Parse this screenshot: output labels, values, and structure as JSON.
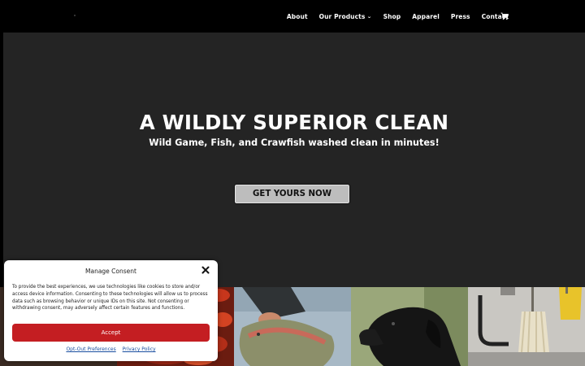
{
  "nav": {
    "items": [
      {
        "label": "About"
      },
      {
        "label": "Our Products",
        "has_dropdown": true
      },
      {
        "label": "Shop"
      },
      {
        "label": "Apparel"
      },
      {
        "label": "Press"
      },
      {
        "label": "Contact"
      }
    ],
    "cart_icon": "shopping-cart-icon"
  },
  "hero": {
    "title": "A WILDLY SUPERIOR CLEAN",
    "subtitle": "Wild Game, Fish, and Crawfish washed clean in minutes!",
    "cta_label": "GET YOURS NOW"
  },
  "photos": [
    {
      "name": "crawfish-photo"
    },
    {
      "name": "crawfish-closeup-photo"
    },
    {
      "name": "fish-catch-photo"
    },
    {
      "name": "black-labrador-photo"
    },
    {
      "name": "mop-sink-photo"
    }
  ],
  "consent": {
    "title": "Manage Consent",
    "body": "To provide the best experiences, we use technologies like cookies to store and/or access device information. Consenting to these technologies will allow us to process data such as browsing behavior or unique IDs on this site. Not consenting or withdrawing consent, may adversely affect certain features and functions.",
    "accept_label": "Accept",
    "opt_out_label": "Opt-Out Preferences",
    "privacy_label": "Privacy Policy"
  },
  "colors": {
    "header_bg": "#000000",
    "hero_bg": "#242424",
    "cta_bg": "#bdbdbd",
    "accept_bg": "#c41e22",
    "link": "#1a4fa0"
  }
}
